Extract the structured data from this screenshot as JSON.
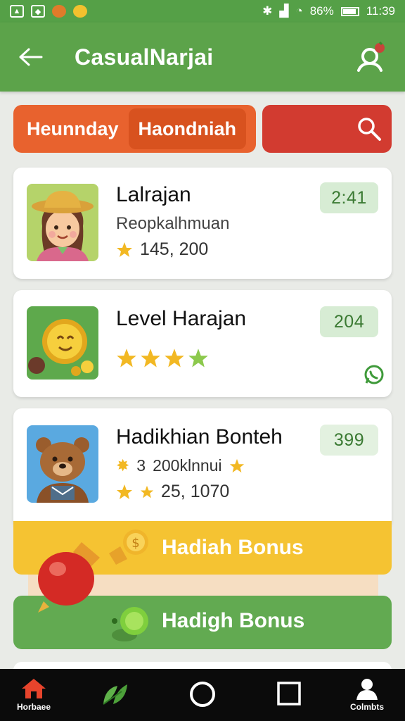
{
  "status_bar": {
    "battery": "86%",
    "time": "11:39",
    "left_icons": [
      "image-icon",
      "photo-icon",
      "cookie-icon",
      "emoji-icon"
    ],
    "right_icons": [
      "bluetooth-icon",
      "signal-icon",
      "wifi-icon",
      "battery-icon"
    ]
  },
  "app_bar": {
    "title": "CasualNarjai"
  },
  "tabs": [
    {
      "label": "Heunnday",
      "active": false
    },
    {
      "label": "Haondniah",
      "active": true
    }
  ],
  "cards": [
    {
      "title": "Lalrajan",
      "subtitle": "Reopkalhmuan",
      "stat": "145, 200",
      "badge": "2:41",
      "thumb": "girl-avatar"
    },
    {
      "title": "Level Harajan",
      "stars": 4,
      "badge": "204",
      "thumb": "coin-avatar"
    },
    {
      "title": "Hadikhian Bonteh",
      "line1_prefix": "3",
      "line1": "200klnnui",
      "line2": "25, 1070",
      "badge": "399",
      "thumb": "bear-avatar"
    }
  ],
  "bonus": {
    "yellow_label": "Hadiah Bonus",
    "green_label": "Hadigh Bonus"
  },
  "bottom_nav": {
    "items": [
      {
        "label": "Horbaee",
        "icon": "home-icon"
      },
      {
        "label": "",
        "icon": "leaf-icon"
      },
      {
        "label": "",
        "icon": "circle-home-icon"
      },
      {
        "label": "",
        "icon": "square-recents-icon"
      },
      {
        "label": "Colmbts",
        "icon": "person-icon"
      }
    ]
  },
  "colors": {
    "app_bar": "#5ca34a",
    "tab_orange": "#e8622e",
    "search_red": "#d23b30",
    "bonus_yellow": "#f5c332",
    "bonus_green": "#62aa51",
    "badge_bg": "#d7ecd4"
  }
}
